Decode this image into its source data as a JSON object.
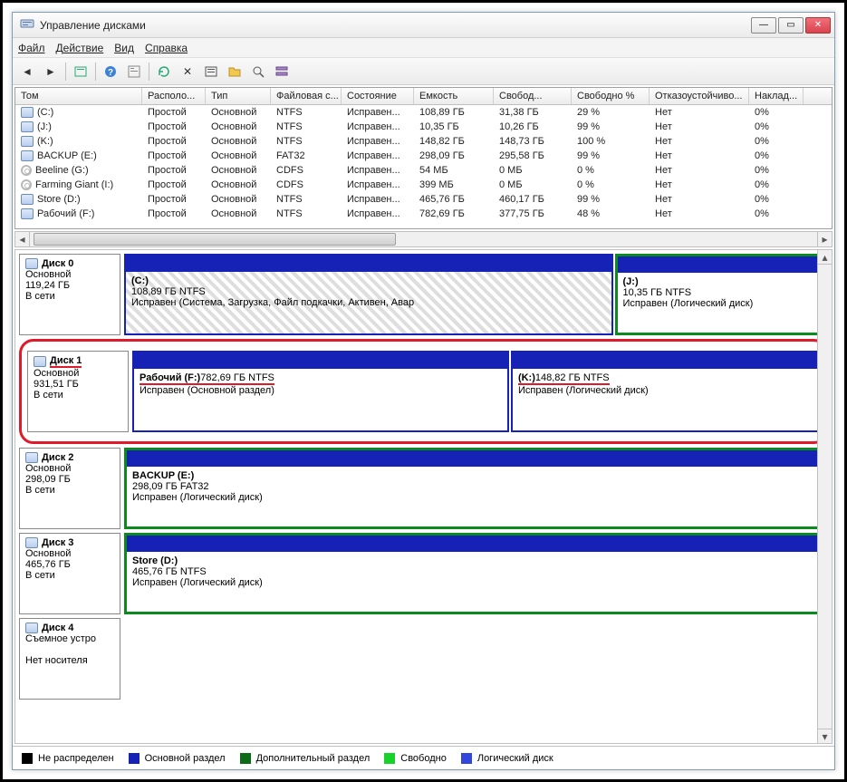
{
  "title": "Управление дисками",
  "menu": {
    "file": "Файл",
    "action": "Действие",
    "view": "Вид",
    "help": "Справка"
  },
  "columns": {
    "vol": "Том",
    "layout": "Располо...",
    "type": "Тип",
    "fs": "Файловая с...",
    "status": "Состояние",
    "capacity": "Емкость",
    "free": "Свобод...",
    "freepct": "Свободно %",
    "fault": "Отказоустойчиво...",
    "overhead": "Наклад..."
  },
  "volumes": [
    {
      "icon": "disk",
      "name": "(C:)",
      "layout": "Простой",
      "type": "Основной",
      "fs": "NTFS",
      "status": "Исправен...",
      "cap": "108,89 ГБ",
      "free": "31,38 ГБ",
      "pct": "29 %",
      "fault": "Нет",
      "ov": "0%"
    },
    {
      "icon": "disk",
      "name": "(J:)",
      "layout": "Простой",
      "type": "Основной",
      "fs": "NTFS",
      "status": "Исправен...",
      "cap": "10,35 ГБ",
      "free": "10,26 ГБ",
      "pct": "99 %",
      "fault": "Нет",
      "ov": "0%"
    },
    {
      "icon": "disk",
      "name": "(K:)",
      "layout": "Простой",
      "type": "Основной",
      "fs": "NTFS",
      "status": "Исправен...",
      "cap": "148,82 ГБ",
      "free": "148,73 ГБ",
      "pct": "100 %",
      "fault": "Нет",
      "ov": "0%"
    },
    {
      "icon": "disk",
      "name": "BACKUP (E:)",
      "layout": "Простой",
      "type": "Основной",
      "fs": "FAT32",
      "status": "Исправен...",
      "cap": "298,09 ГБ",
      "free": "295,58 ГБ",
      "pct": "99 %",
      "fault": "Нет",
      "ov": "0%"
    },
    {
      "icon": "cd",
      "name": "Beeline (G:)",
      "layout": "Простой",
      "type": "Основной",
      "fs": "CDFS",
      "status": "Исправен...",
      "cap": "54 МБ",
      "free": "0 МБ",
      "pct": "0 %",
      "fault": "Нет",
      "ov": "0%"
    },
    {
      "icon": "cd",
      "name": "Farming Giant (I:)",
      "layout": "Простой",
      "type": "Основной",
      "fs": "CDFS",
      "status": "Исправен...",
      "cap": "399 МБ",
      "free": "0 МБ",
      "pct": "0 %",
      "fault": "Нет",
      "ov": "0%"
    },
    {
      "icon": "disk",
      "name": "Store (D:)",
      "layout": "Простой",
      "type": "Основной",
      "fs": "NTFS",
      "status": "Исправен...",
      "cap": "465,76 ГБ",
      "free": "460,17 ГБ",
      "pct": "99 %",
      "fault": "Нет",
      "ov": "0%"
    },
    {
      "icon": "disk",
      "name": "Рабочий (F:)",
      "layout": "Простой",
      "type": "Основной",
      "fs": "NTFS",
      "status": "Исправен...",
      "cap": "782,69 ГБ",
      "free": "377,75 ГБ",
      "pct": "48 %",
      "fault": "Нет",
      "ov": "0%"
    }
  ],
  "disks": {
    "0": {
      "name": "Диск 0",
      "type": "Основной",
      "size": "119,24 ГБ",
      "state": "В сети",
      "parts": [
        {
          "title": "(C:)",
          "line2": "108,89 ГБ NTFS",
          "line3": "Исправен (Система, Загрузка, Файл подкачки, Активен, Авар",
          "style": "system",
          "bar": "blue",
          "border": "blue",
          "flex": 70
        },
        {
          "title": "(J:)",
          "line2": "10,35 ГБ NTFS",
          "line3": "Исправен (Логический диск)",
          "bar": "blue",
          "border": "green",
          "flex": 30
        }
      ]
    },
    "1": {
      "name": "Диск 1",
      "type": "Основной",
      "size": "931,51 ГБ",
      "state": "В сети",
      "highlight": true,
      "parts": [
        {
          "title": "Рабочий  (F:)",
          "line2": "782,69 ГБ NTFS",
          "line3": "Исправен (Основной раздел)",
          "bar": "blue",
          "border": "blue",
          "flex": 55,
          "underline": true
        },
        {
          "title": "(K:)",
          "line2": "148,82 ГБ NTFS",
          "line3": "Исправен (Логический диск)",
          "bar": "blue",
          "border": "blue",
          "flex": 45,
          "underline": true
        }
      ]
    },
    "2": {
      "name": "Диск 2",
      "type": "Основной",
      "size": "298,09 ГБ",
      "state": "В сети",
      "parts": [
        {
          "title": "BACKUP  (E:)",
          "line2": "298,09 ГБ FAT32",
          "line3": "Исправен (Логический диск)",
          "bar": "blue",
          "border": "green",
          "flex": 100
        }
      ]
    },
    "3": {
      "name": "Диск 3",
      "type": "Основной",
      "size": "465,76 ГБ",
      "state": "В сети",
      "parts": [
        {
          "title": "Store  (D:)",
          "line2": "465,76 ГБ NTFS",
          "line3": "Исправен (Логический диск)",
          "bar": "blue",
          "border": "green",
          "flex": 100
        }
      ]
    },
    "4": {
      "name": "Диск 4",
      "type": "Съемное устро",
      "size": "",
      "state": "Нет носителя",
      "parts": []
    }
  },
  "legend": {
    "unallocated": "Не распределен",
    "primary": "Основной раздел",
    "extended": "Дополнительный раздел",
    "free": "Свободно",
    "logical": "Логический диск"
  }
}
